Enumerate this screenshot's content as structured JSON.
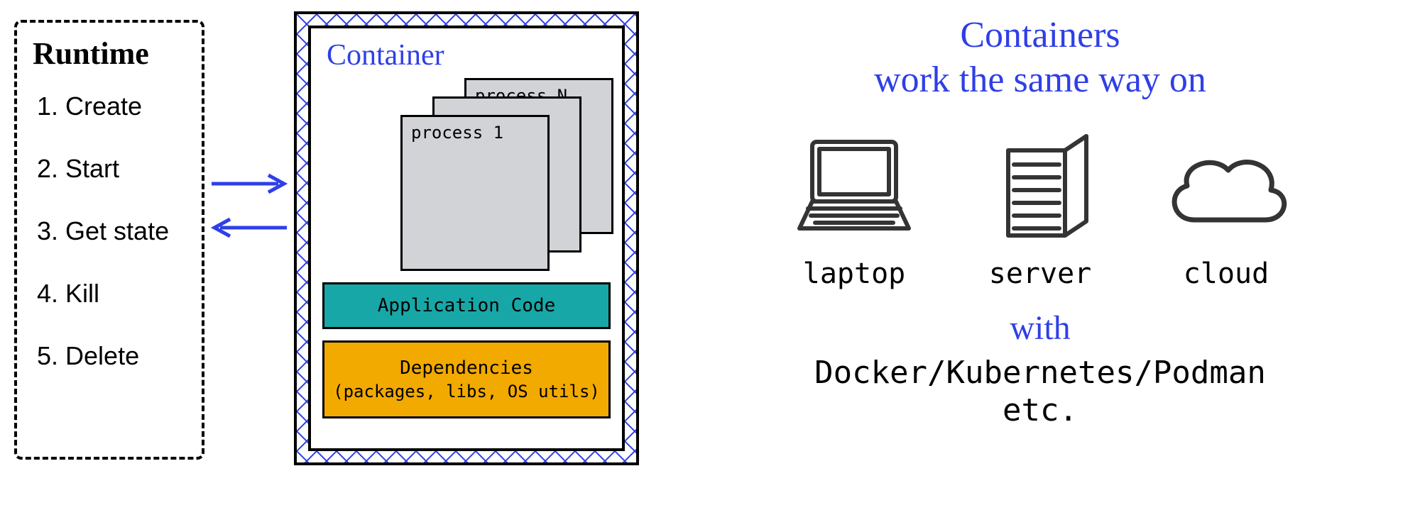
{
  "runtime": {
    "title": "Runtime",
    "items": [
      "1. Create",
      "2. Start",
      "3. Get state",
      "4. Kill",
      "5. Delete"
    ]
  },
  "container": {
    "title": "Container",
    "processes": {
      "first": "process 1",
      "ellipsis": "...",
      "last": "process N"
    },
    "app_code": "Application Code",
    "deps_title": "Dependencies",
    "deps_sub": "(packages, libs, OS utils)"
  },
  "right": {
    "line1": "Containers",
    "line2": "work the same way on",
    "laptop": "laptop",
    "server": "server",
    "cloud": "cloud",
    "with": "with",
    "tools1": "Docker/Kubernetes/Podman",
    "tools2": "etc."
  },
  "colors": {
    "blue": "#2f3fe6",
    "teal": "#18a7a7",
    "orange": "#f2a900",
    "grey": "#d2d3d7"
  }
}
